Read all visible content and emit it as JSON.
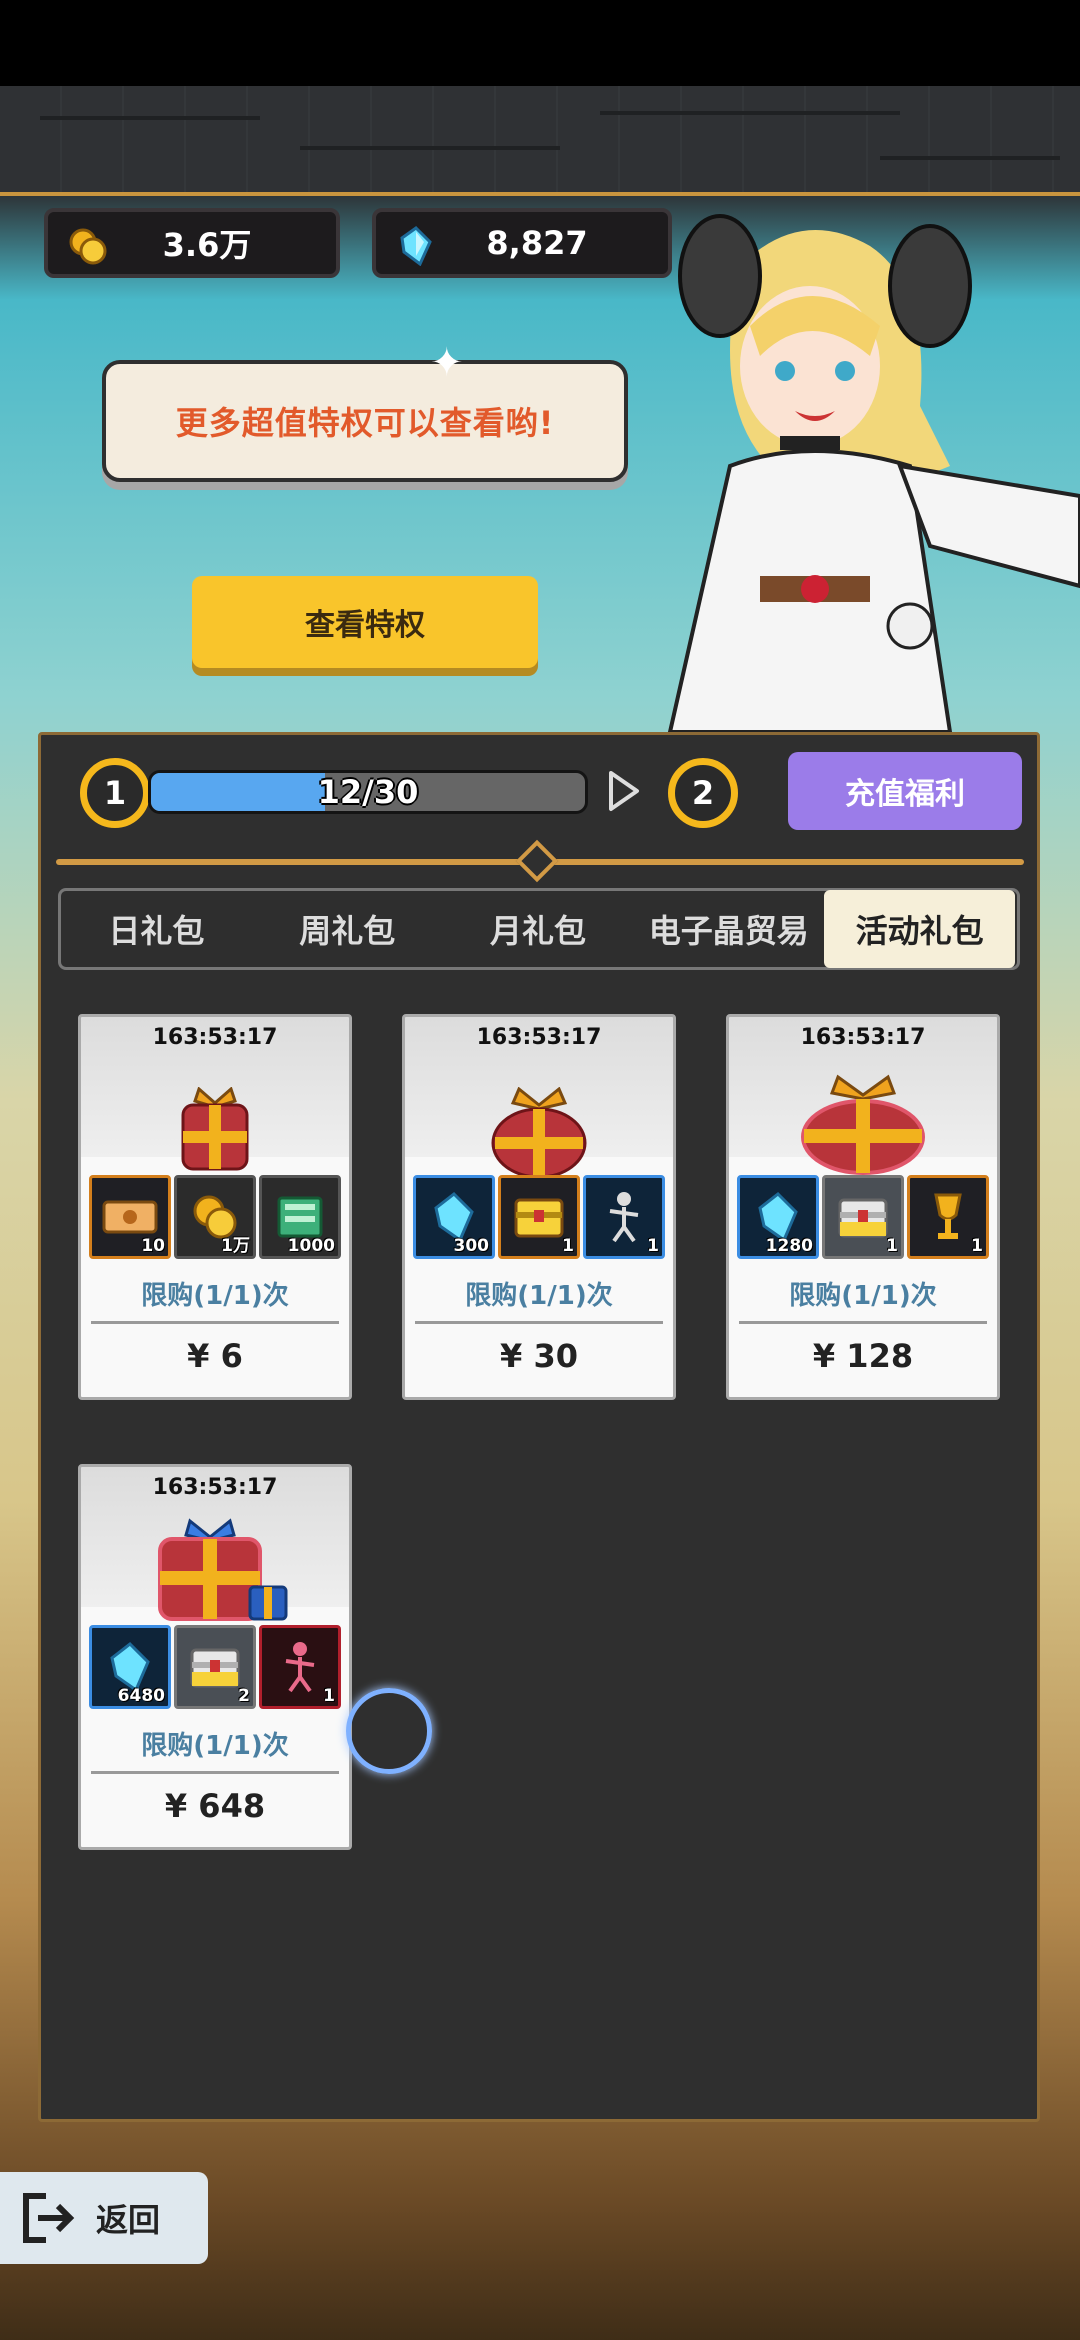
{
  "currency": {
    "gold": "3.6万",
    "crystal": "8,827"
  },
  "speech_text": "更多超值特权可以查看哟!",
  "view_privilege_label": "查看特权",
  "progress": {
    "start_level": "1",
    "end_level": "2",
    "text": "12/30",
    "current": 12,
    "max": 30
  },
  "recharge_label": "充值福利",
  "tabs": [
    "日礼包",
    "周礼包",
    "月礼包",
    "电子晶贸易",
    "活动礼包"
  ],
  "active_tab": "活动礼包",
  "packs": [
    {
      "timer": "163:53:17",
      "items": [
        {
          "icon": "ticket-icon",
          "qty": "10"
        },
        {
          "icon": "gold-coin-icon",
          "qty": "1万"
        },
        {
          "icon": "book-icon",
          "qty": "1000"
        }
      ],
      "limit": "限购(1/1)次",
      "price": "¥ 6"
    },
    {
      "timer": "163:53:17",
      "items": [
        {
          "icon": "crystal-icon",
          "qty": "300"
        },
        {
          "icon": "chest-icon",
          "qty": "1"
        },
        {
          "icon": "figure-icon",
          "qty": "1"
        }
      ],
      "limit": "限购(1/1)次",
      "price": "¥ 30"
    },
    {
      "timer": "163:53:17",
      "items": [
        {
          "icon": "crystal-icon",
          "qty": "1280"
        },
        {
          "icon": "chest-icon",
          "qty": "1"
        },
        {
          "icon": "trophy-icon",
          "qty": "1"
        }
      ],
      "limit": "限购(1/1)次",
      "price": "¥ 128"
    },
    {
      "timer": "163:53:17",
      "items": [
        {
          "icon": "crystal-icon",
          "qty": "6480"
        },
        {
          "icon": "chest-icon",
          "qty": "2"
        },
        {
          "icon": "figure-icon",
          "qty": "1"
        }
      ],
      "limit": "限购(1/1)次",
      "price": "¥ 648"
    }
  ],
  "back_label": "返回",
  "colors": {
    "accent_gold": "#f5b81c",
    "button_purple": "#9b7ce9",
    "button_yellow": "#f9c52b",
    "progress_blue": "#58a7f0",
    "limit_text": "#4a7fa1"
  }
}
